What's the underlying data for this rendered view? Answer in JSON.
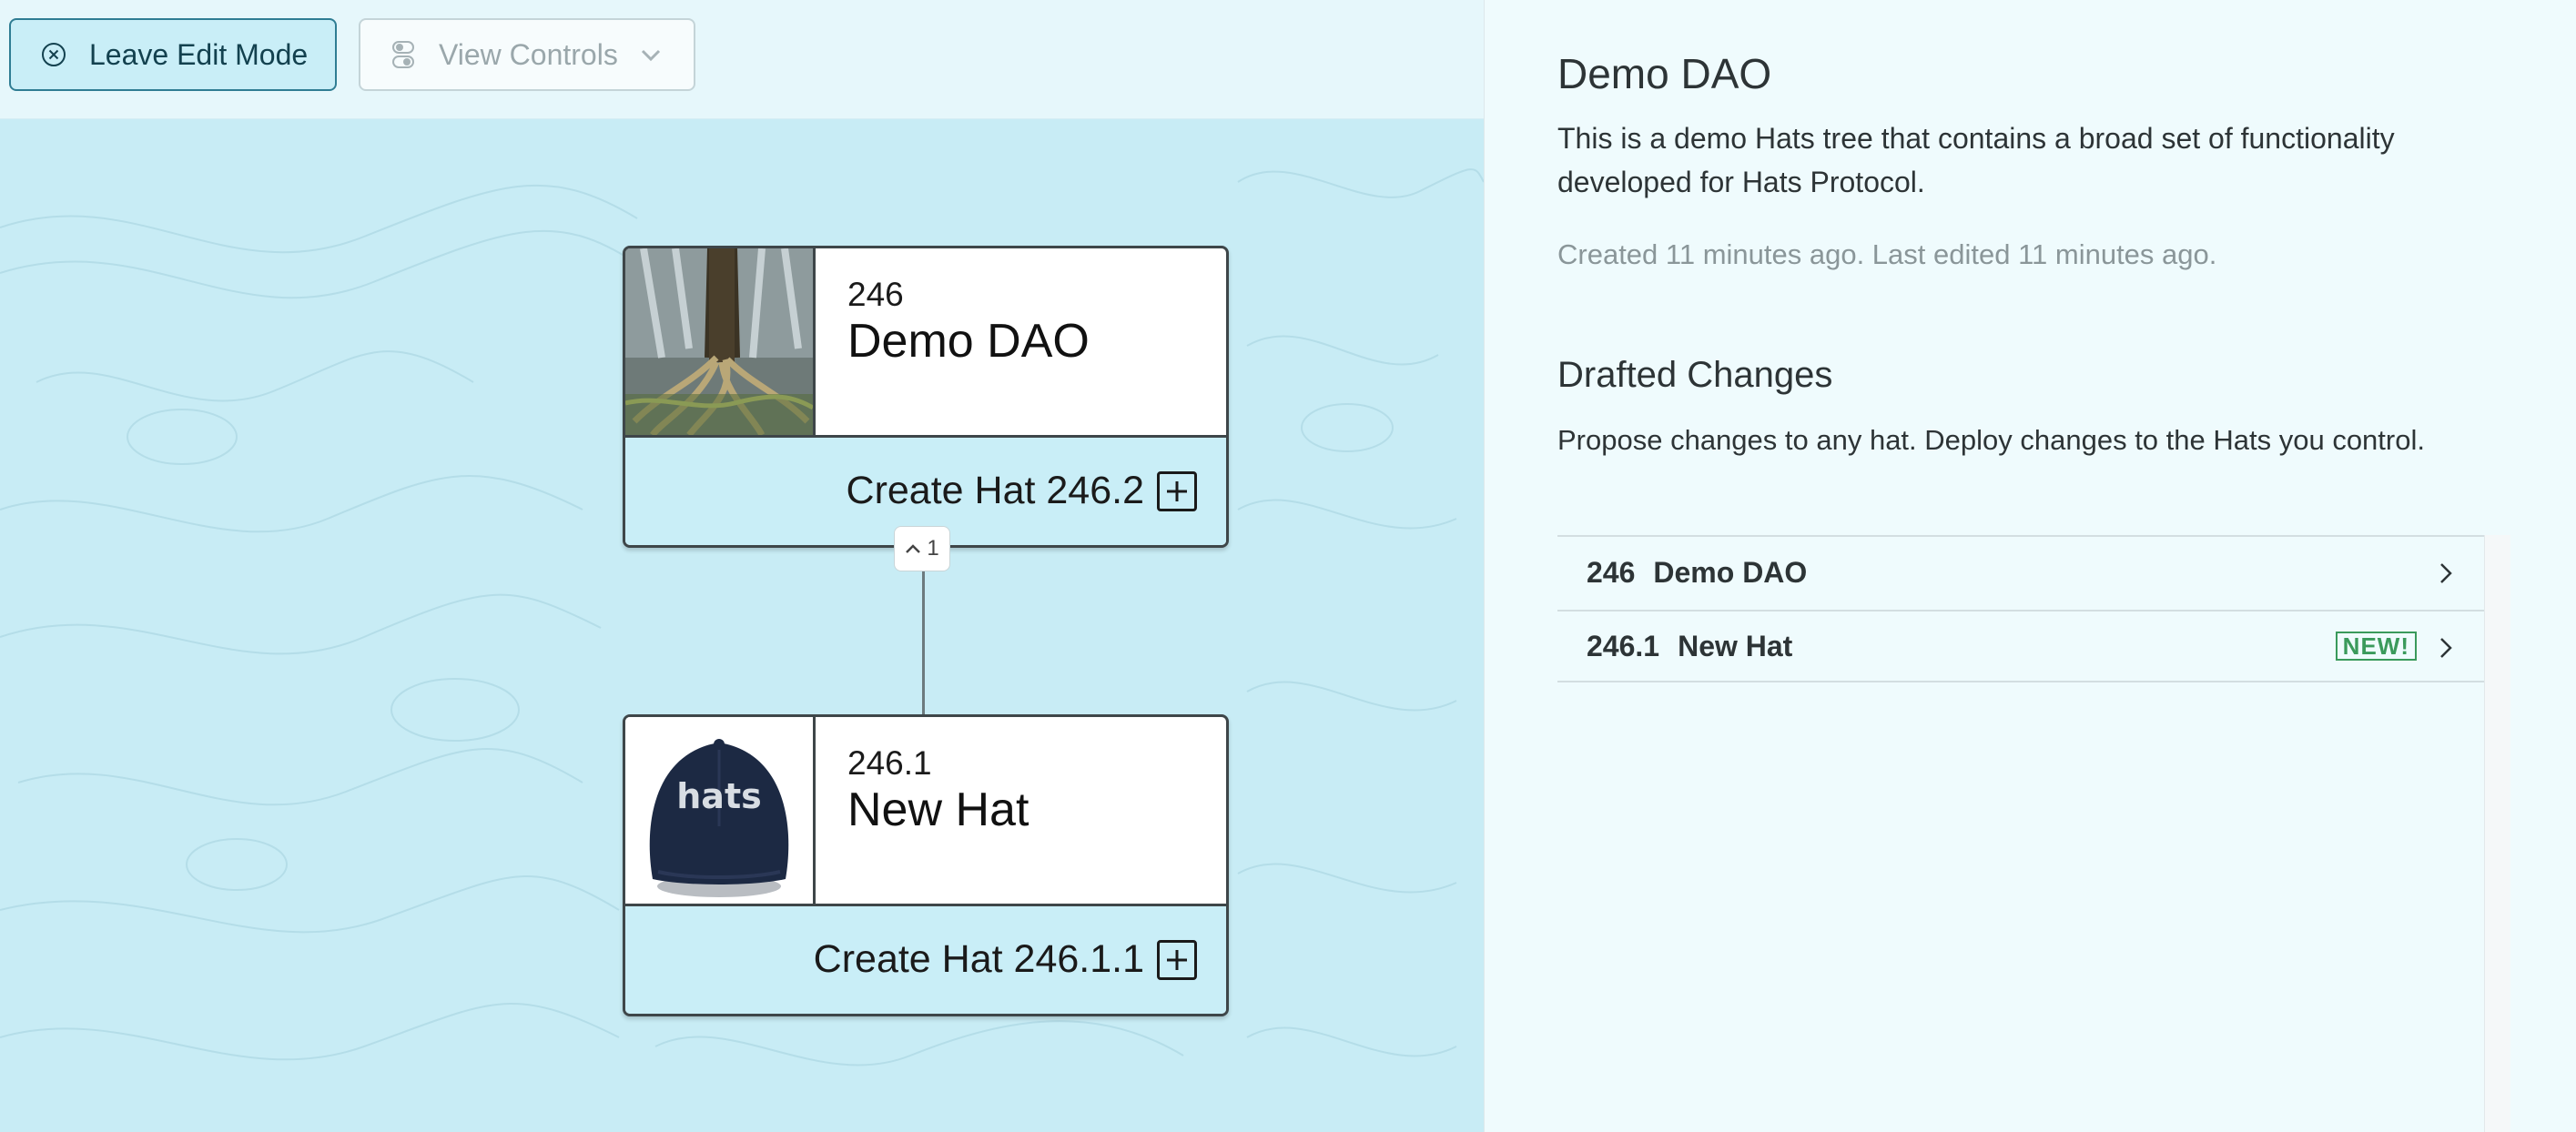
{
  "toolbar": {
    "leave_label": "Leave Edit Mode",
    "view_label": "View Controls"
  },
  "tree": {
    "nodes": [
      {
        "id": "246",
        "name": "Demo DAO",
        "create_label": "Create Hat 246.2",
        "image": "waterfall-tree-roots"
      },
      {
        "id": "246.1",
        "name": "New Hat",
        "create_label": "Create Hat 246.1.1",
        "image": "navy-hats-cap"
      }
    ],
    "collapse_count": "1",
    "cap_text": "hats"
  },
  "panel": {
    "title": "Demo DAO",
    "description": "This is a demo Hats tree that contains a broad set of functionality developed for Hats Protocol.",
    "meta": "Created 11 minutes ago. Last edited 11 minutes ago.",
    "drafted_heading": "Drafted Changes",
    "drafted_sub": "Propose changes to any hat. Deploy changes to the Hats you control.",
    "changes": [
      {
        "id": "246",
        "name": "Demo DAO",
        "badge": ""
      },
      {
        "id": "246.1",
        "name": "New Hat",
        "badge": "NEW!"
      }
    ]
  },
  "colors": {
    "canvas_bg": "#c8ecf5",
    "accent": "#2f7d93",
    "new_badge": "#3a9a5b"
  }
}
